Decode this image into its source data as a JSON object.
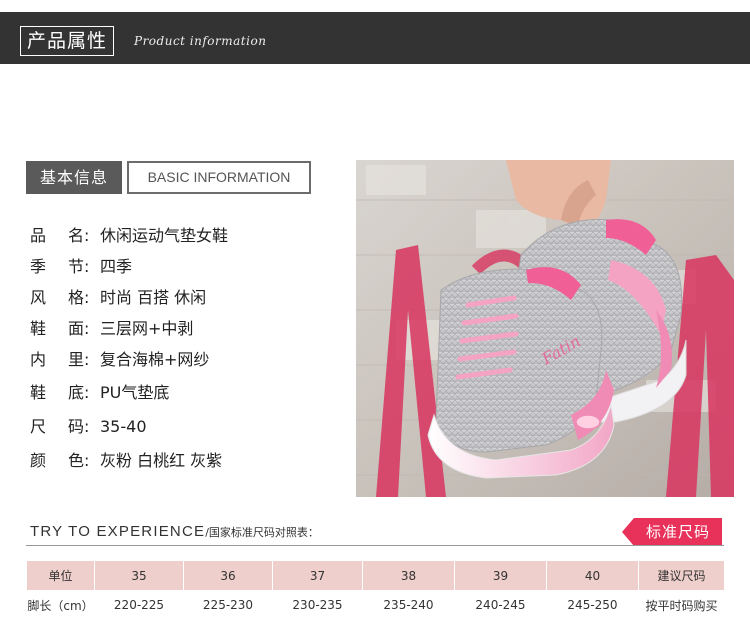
{
  "header": {
    "title": "产品属性",
    "subtitle": "Product information"
  },
  "basic": {
    "label_cn": "基本信息",
    "label_en": "BASIC INFORMATION"
  },
  "specs": [
    {
      "key1": "品",
      "key2": "名:",
      "value": "休闲运动气垫女鞋"
    },
    {
      "key1": "季",
      "key2": "节:",
      "value": "四季"
    },
    {
      "key1": "风",
      "key2": "格:",
      "value": "时尚 百搭 休闲"
    },
    {
      "key1": "鞋",
      "key2": "面:",
      "value": "三层网+中剥"
    },
    {
      "key1": "内",
      "key2": "里:",
      "value": "复合海棉+网纱"
    },
    {
      "key1": "鞋",
      "key2": "底:",
      "value": "PU气垫底"
    },
    {
      "key1": "尺",
      "key2": "码:",
      "value": "35-40"
    },
    {
      "key1": "颜",
      "key2": "色:",
      "value": "灰粉 白桃红 灰紫"
    }
  ],
  "photo": {
    "brand_text": "Fatin"
  },
  "size_section": {
    "try_text": "TRY TO EXPERIENCE",
    "try_text_cn": "/国家标准尺码对照表：",
    "tag_label": "标准尺码",
    "header_row": [
      "单位",
      "35",
      "36",
      "37",
      "38",
      "39",
      "40",
      "建议尺码"
    ],
    "data_row": [
      "脚长（cm）",
      "220-225",
      "225-230",
      "230-235",
      "235-240",
      "240-245",
      "245-250",
      "按平时码购买"
    ]
  },
  "colors": {
    "header_bg": "#333333",
    "label_bg": "#5a5a5a",
    "accent_pink": "#e8325a",
    "table_head_bg": "#eecfcb"
  }
}
